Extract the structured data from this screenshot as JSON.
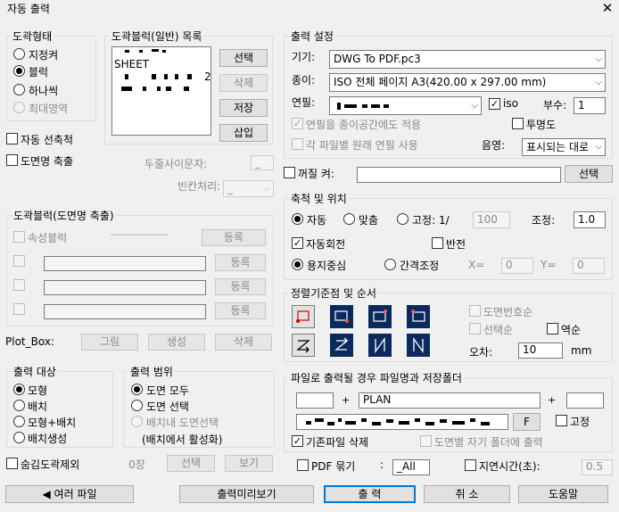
{
  "window": {
    "title": "자동 출력",
    "close": "✕"
  },
  "sheet_type": {
    "label": "도곽형태",
    "options": [
      "지정켜",
      "블럭",
      "하나씩",
      "최대영역"
    ],
    "selected": "블럭"
  },
  "block_list": {
    "label": "도곽블럭(일반) 목록",
    "items": [
      "SHEET",
      "2"
    ],
    "buttons": {
      "select": "선택",
      "delete": "삭제",
      "save": "저장",
      "insert": "삽입"
    }
  },
  "auto_select": {
    "label": "자동 선축척",
    "checked": false
  },
  "name_scale": {
    "label": "도면명 축출",
    "checked": false
  },
  "separator": {
    "label": "두줄사이문자:",
    "value": "_"
  },
  "blank_handling": {
    "label": "빈칸처리:",
    "value": "_"
  },
  "name_block": {
    "label": "도곽블럭(도면명 축출)",
    "attr_block": "속성블럭",
    "dashes": "------------------",
    "register": "등록"
  },
  "plot_box": {
    "label": "Plot_Box:",
    "buttons": [
      "그림",
      "생성",
      "삭제"
    ]
  },
  "print_target": {
    "label": "출력 대상",
    "options": [
      "모형",
      "배치",
      "모형+배치",
      "배치생성"
    ],
    "selected": "모형"
  },
  "print_range": {
    "label": "출력 범위",
    "options": [
      "도면 모두",
      "도면 선택",
      "배치내 도면선택"
    ],
    "note": "(배치에서 활성화)",
    "selected": "도면 모두"
  },
  "hidden_exclude": {
    "label": "숨김도곽제외",
    "count": "0장",
    "select": "선택",
    "view": "보기"
  },
  "output_settings": {
    "label": "출력 설정",
    "device_label": "기기:",
    "device": "DWG To PDF.pc3",
    "paper_label": "종이:",
    "paper": "ISO 전체 페이지 A3(420.00 x 297.00 mm)",
    "pen_label": "연필:",
    "iso_label": "iso",
    "iso_checked": true,
    "copies_label": "부수:",
    "copies": "1",
    "apply_to_paper": "연필을 종이공간에도 적용",
    "transparency": "투명도",
    "each_file_pen": "각 파일별 원래 연필 사용",
    "shade_label": "음영:",
    "shade": "표시되는 대로"
  },
  "off_layer": {
    "label": "꺼질 켜:",
    "select": "선택"
  },
  "scale_pos": {
    "label": "축척 및 위치",
    "modes": [
      "자동",
      "맞춤",
      "고정: 1/"
    ],
    "selected": "자동",
    "fixed_value": "100",
    "adjust_label": "조정:",
    "adjust": "1.0",
    "auto_rotate": "자동회전",
    "auto_rotate_checked": true,
    "mirror": "반전",
    "center_options": [
      "용지중심",
      "간격조정"
    ],
    "center_selected": "용지중심",
    "x_label": "X=",
    "x": "0",
    "y_label": "Y=",
    "y": "0"
  },
  "sort": {
    "label": "정렬기준점 및 순서",
    "by_number": "도면번호순",
    "by_select": "선택순",
    "reverse": "역순",
    "tolerance_label": "오차:",
    "tolerance": "10",
    "unit": "mm"
  },
  "file_out": {
    "label": "파일로 출력될 경우 파일명과 저장폴더",
    "prefix": "",
    "name": "PLAN",
    "suffix": "",
    "plus": "+",
    "folder_button": "F",
    "fixed": "고정",
    "delete_old": "기존파일 삭제",
    "delete_old_checked": true,
    "own_folder": "도면별 자기 폴더에 출력"
  },
  "pdf_merge": {
    "label": "PDF 묶기",
    "colon": ":",
    "value": "_All"
  },
  "delay": {
    "label": "지연시간(초):",
    "value": "0.5"
  },
  "footer": {
    "multi_file": "◀ 여러 파일",
    "preview": "출력미리보기",
    "print": "출   력",
    "cancel": "취   소",
    "help": "도움말"
  }
}
